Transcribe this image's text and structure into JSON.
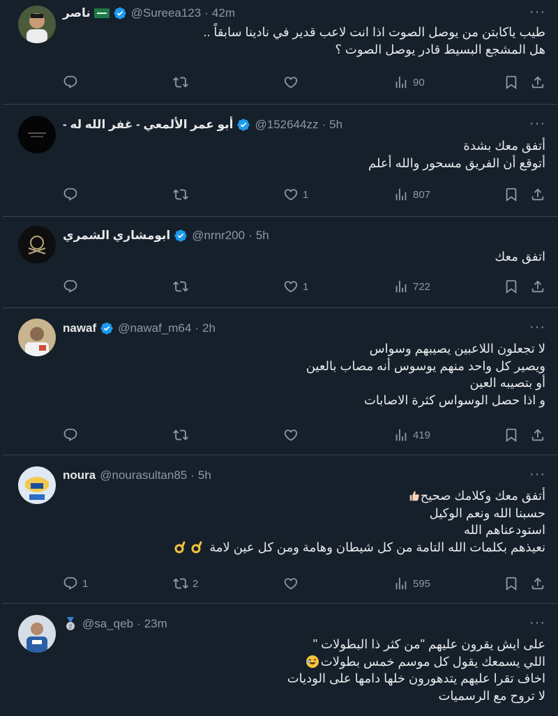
{
  "tweets": [
    {
      "name": "ناصر",
      "handle": "@Sureea123",
      "dot": "·",
      "time": "42m",
      "lines": [
        "طيب ياكابتن من يوصل الصوت اذا انت لاعب قدير في نادينا سابقاً ..",
        "هل المشجع البسيط قادر يوصل الصوت ؟"
      ],
      "replies": "",
      "retweets": "",
      "likes": "",
      "views": "90",
      "avatar_color": "#2f3f2a"
    },
    {
      "name": "- أبو عمر الألمعي - غفر الله له",
      "handle": "@152644zz",
      "dot": "·",
      "time": "5h",
      "lines": [
        "أتفق معك بشدة",
        "أتوقع أن الفريق مسحور والله أعلم"
      ],
      "replies": "",
      "retweets": "",
      "likes": "1",
      "views": "807",
      "avatar_color": "#0a0a0a"
    },
    {
      "name": "ابومشاري الشمري",
      "handle": "@nrnr200",
      "dot": "·",
      "time": "5h",
      "lines": [
        "اتفق معك"
      ],
      "replies": "",
      "retweets": "",
      "likes": "1",
      "views": "722",
      "avatar_color": "#111111"
    },
    {
      "name": "nawaf",
      "handle": "@nawaf_m64",
      "dot": "·",
      "time": "2h",
      "lines": [
        "لا تجعلون اللاعبين يصيبهم وسواس",
        "ويصير كل واحد منهم يوسوس أنه مصاب بالعين",
        "أو بتصيبه العين",
        "و اذا حصل الوسواس كثرة الاصابات"
      ],
      "replies": "",
      "retweets": "",
      "likes": "",
      "views": "419",
      "avatar_color": "#c9b89a"
    },
    {
      "name": "noura",
      "handle": "@nourasultan85",
      "dot": "·",
      "time": "5h",
      "lines": [
        "أتفق معك وكلامك صحيح",
        "حسبنا الله ونعم الوكيل",
        "استودعناهم الله",
        "نعيذهم بكلمات الله التامة من كل شيطان وهامة ومن كل عين لامة"
      ],
      "replies": "1",
      "retweets": "2",
      "likes": "",
      "views": "595",
      "avatar_color": "#e7eef6"
    },
    {
      "name": "",
      "handle": "@sa_qeb",
      "dot": "·",
      "time": "23m",
      "lines": [
        "على ايش يقرون عليهم \"من كثر ذا البطولات \"",
        "اللي يسمعك يقول كل موسم خمس بطولات",
        "اخاف تقرا عليهم يتدهورون خلها دامها على الوديات",
        "لا تروح مع الرسميات"
      ],
      "replies": "",
      "retweets": "",
      "likes": "",
      "views": "",
      "avatar_color": "#3a6fb0"
    }
  ],
  "icons": {
    "more": "more-icon",
    "reply": "reply-icon",
    "retweet": "retweet-icon",
    "like": "heart-icon",
    "views": "views-icon",
    "bookmark": "bookmark-icon",
    "share": "share-icon",
    "verified": "verified-badge-icon"
  },
  "colors": {
    "background": "#15202b",
    "text": "#e7e9ea",
    "muted": "#8b98a5",
    "divider": "#38444d",
    "verified": "#1d9bf0"
  }
}
